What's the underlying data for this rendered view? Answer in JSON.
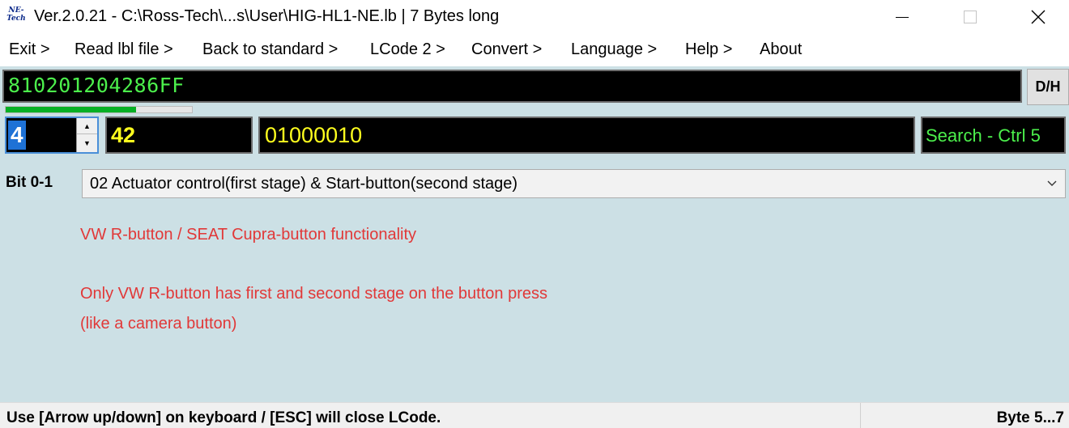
{
  "window": {
    "icon_text": "NE-\nTech",
    "title": "Ver.2.0.21 - C:\\Ross-Tech\\...s\\User\\HIG-HL1-NE.lb | 7 Bytes long",
    "minimize_icon": "minimize-icon",
    "maximize_icon": "maximize-icon",
    "close_icon": "close-icon",
    "close_glyph": "✕"
  },
  "menu": {
    "items": [
      {
        "label": "Exit >"
      },
      {
        "label": "Read lbl file >"
      },
      {
        "label": "Back to standard >"
      },
      {
        "label": "LCode 2 >"
      },
      {
        "label": "Convert >"
      },
      {
        "label": "Language >"
      },
      {
        "label": "Help >"
      },
      {
        "label": "About"
      }
    ]
  },
  "coding": {
    "hex_string": "810201204286FF",
    "dh_button": "D/H",
    "progress_fraction": 0.7,
    "byte_index": "4",
    "byte_hex": "42",
    "byte_binary": "01000010",
    "search_label": "Search - Ctrl 5",
    "spin_up_glyph": "▲",
    "spin_down_glyph": "▼"
  },
  "bit_field": {
    "label": "Bit 0-1",
    "selected": "02 Actuator control(first stage) & Start-button(second stage)"
  },
  "info_lines": [
    "VW R-button / SEAT Cupra-button functionality",
    "Only VW R-button has first and second stage on the button press",
    "(like a camera button)"
  ],
  "status": {
    "hint": "Use [Arrow up/down] on keyboard / [ESC] will close LCode.",
    "byte_range": "Byte 5...7"
  },
  "colors": {
    "panel_bg": "#cce0e5",
    "hex_text": "#4cf04c",
    "byte_text": "#ffff1e",
    "info_text": "#e13838",
    "progress_fill": "#06b025"
  }
}
